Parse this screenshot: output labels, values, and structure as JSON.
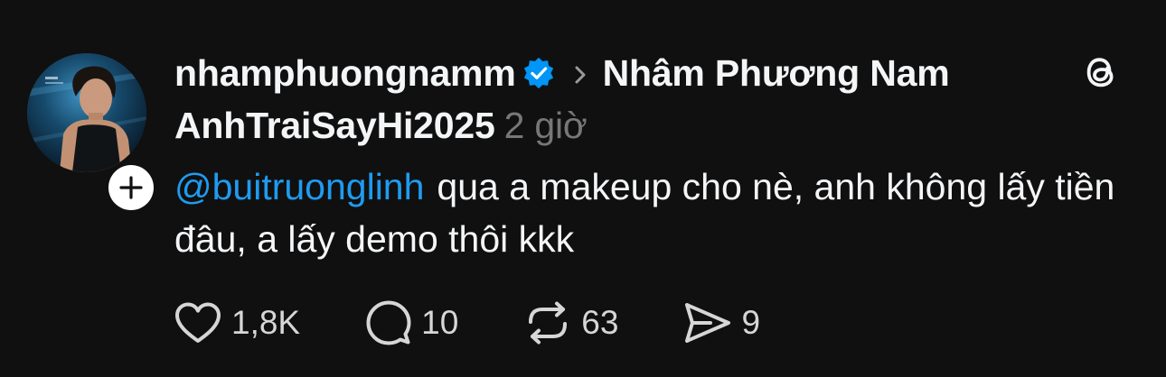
{
  "post": {
    "username": "nhamphuongnamm",
    "verified": true,
    "reply_target": "Nhâm Phương Nam AnhTraiSayHi2025",
    "timestamp": "2 giờ",
    "mention": "@buitruonglinh",
    "text": "qua a makeup cho nè, anh không lấy tiền đâu, a lấy demo thôi kkk"
  },
  "actions": {
    "likes": "1,8K",
    "replies": "10",
    "reposts": "63",
    "shares": "9"
  },
  "icons": {
    "verified": "verified-badge-icon",
    "chevron": "chevron-right-icon",
    "app": "threads-logo-icon",
    "follow": "plus-icon",
    "like": "heart-icon",
    "reply": "speech-bubble-icon",
    "repost": "repost-icon",
    "share": "send-icon"
  },
  "colors": {
    "background": "#101010",
    "text": "#f3f5f7",
    "muted": "#777777",
    "link": "#1f9bf0",
    "verified": "#0095f6"
  }
}
